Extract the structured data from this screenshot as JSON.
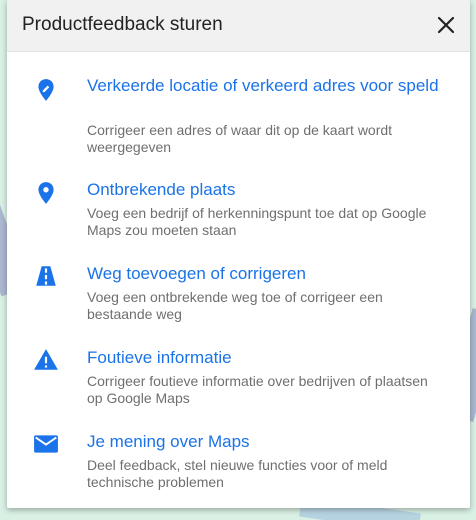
{
  "dialog": {
    "title": "Productfeedback sturen",
    "close_icon": "close-icon"
  },
  "items": [
    {
      "icon": "pin-edit-icon",
      "title": "Verkeerde locatie of verkeerd adres voor speld",
      "description": "Corrigeer een adres of waar dit op de kaart wordt weergegeven"
    },
    {
      "icon": "pin-icon",
      "title": "Ontbrekende plaats",
      "description": "Voeg een bedrijf of herkenningspunt toe dat op Google Maps zou moeten staan"
    },
    {
      "icon": "road-icon",
      "title": "Weg toevoegen of corrigeren",
      "description": "Voeg een ontbrekende weg toe of corrigeer een bestaande weg"
    },
    {
      "icon": "warning-icon",
      "title": "Foutieve informatie",
      "description": "Corrigeer foutieve informatie over bedrijven of plaatsen op Google Maps"
    },
    {
      "icon": "mail-icon",
      "title": "Je mening over Maps",
      "description": "Deel feedback, stel nieuwe functies voor of meld technische problemen"
    }
  ],
  "colors": {
    "accent": "#1a73e8",
    "map_background": "#d9f0e4"
  }
}
